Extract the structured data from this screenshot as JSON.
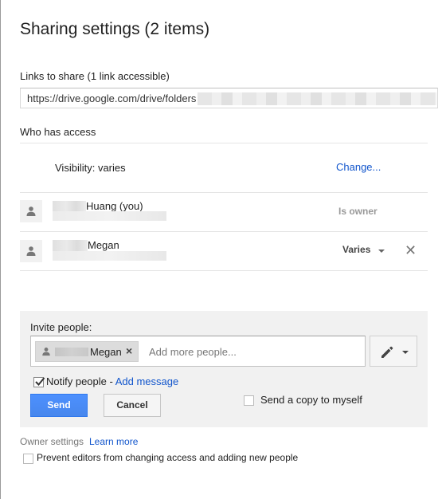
{
  "dialog": {
    "title": "Sharing settings (2 items)"
  },
  "links": {
    "label": "Links to share (1 link accessible)",
    "url": "https://drive.google.com/drive/folders"
  },
  "access": {
    "label": "Who has access",
    "visibility_text": "Visibility: varies",
    "change_link": "Change...",
    "people": [
      {
        "name": "Huang (you)",
        "role": "Is owner",
        "icon": "person-icon"
      },
      {
        "name": "Megan",
        "role": "Varies",
        "icon": "person-icon"
      }
    ]
  },
  "invite": {
    "label": "Invite people:",
    "chip_name": "Megan",
    "chip_remove": "×",
    "placeholder": "Add more people...",
    "permission_icon": "pencil-icon",
    "notify_label": "Notify people",
    "notify_separator": " - ",
    "add_message": "Add message",
    "notify_checked": true,
    "copy_label": "Send a copy to myself",
    "copy_checked": false,
    "send_label": "Send",
    "cancel_label": "Cancel"
  },
  "owner": {
    "label": "Owner settings",
    "learn_more": "Learn more",
    "prevent_label": "Prevent editors from changing access and adding new people",
    "prevent_checked": false
  },
  "colors": {
    "link": "#1155cc",
    "send_button": "#4d90fe",
    "panel_bg": "#f1f1f1"
  }
}
